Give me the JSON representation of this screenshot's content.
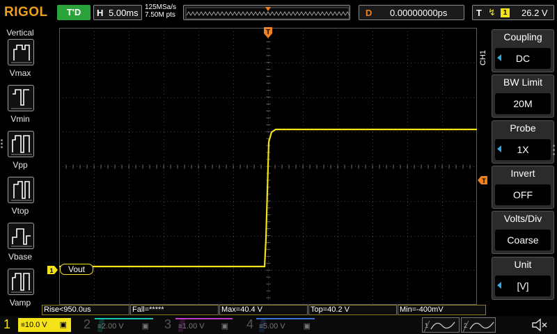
{
  "header": {
    "logo": "RIGOL",
    "trigger_status": "T'D",
    "horizontal": {
      "key": "H",
      "value": "5.00ms"
    },
    "sample_rate": "125MSa/s",
    "memory_depth": "7.50M pts",
    "delay": {
      "key": "D",
      "value": "0.00000000ps"
    },
    "trigger": {
      "key": "T",
      "edge": "↑",
      "source": "1",
      "level": "26.2 V"
    }
  },
  "measure_panel": {
    "title": "Vertical",
    "items": [
      {
        "label": "Vmax",
        "icon": "vmax-waveform-icon"
      },
      {
        "label": "Vmin",
        "icon": "vmin-waveform-icon"
      },
      {
        "label": "Vpp",
        "icon": "vpp-waveform-icon"
      },
      {
        "label": "Vtop",
        "icon": "vtop-waveform-icon"
      },
      {
        "label": "Vbase",
        "icon": "vbase-waveform-icon"
      },
      {
        "label": "Vamp",
        "icon": "vamp-waveform-icon"
      }
    ]
  },
  "waveform": {
    "channel_marker": "1",
    "label": "Vout",
    "color": "#f5e31a",
    "trigger_marker": "T",
    "trigger_level_marker": "T"
  },
  "menu": {
    "channel_tag": "CH1",
    "items": [
      {
        "title": "Coupling",
        "value": "DC",
        "has_arrow": true
      },
      {
        "title": "BW Limit",
        "value": "20M",
        "has_arrow": false
      },
      {
        "title": "Probe",
        "value": "1X",
        "has_arrow": true
      },
      {
        "title": "Invert",
        "value": "OFF",
        "has_arrow": false
      },
      {
        "title": "Volts/Div",
        "value": "Coarse",
        "has_arrow": false
      },
      {
        "title": "Unit",
        "value": "[V]",
        "has_arrow": true
      }
    ]
  },
  "measurements": [
    "Rise<950.0us",
    "Fall=*****",
    "Max=40.4 V",
    "Top=40.2 V",
    "Min=-400mV"
  ],
  "channels": [
    {
      "num": "1",
      "scale": "10.0 V",
      "color": "#f5e31a",
      "active": true
    },
    {
      "num": "2",
      "scale": "2.00 V",
      "color": "#19c6b4",
      "active": false
    },
    {
      "num": "3",
      "scale": "1.00 V",
      "color": "#c23ac8",
      "active": false
    },
    {
      "num": "4",
      "scale": "5.00 V",
      "color": "#3a72d8",
      "active": false
    }
  ],
  "math_buttons": [
    "1",
    "2"
  ],
  "colors": {
    "accent_orange": "#f08020",
    "run_green": "#2aa43a",
    "arrow_blue": "#38a8e0"
  }
}
